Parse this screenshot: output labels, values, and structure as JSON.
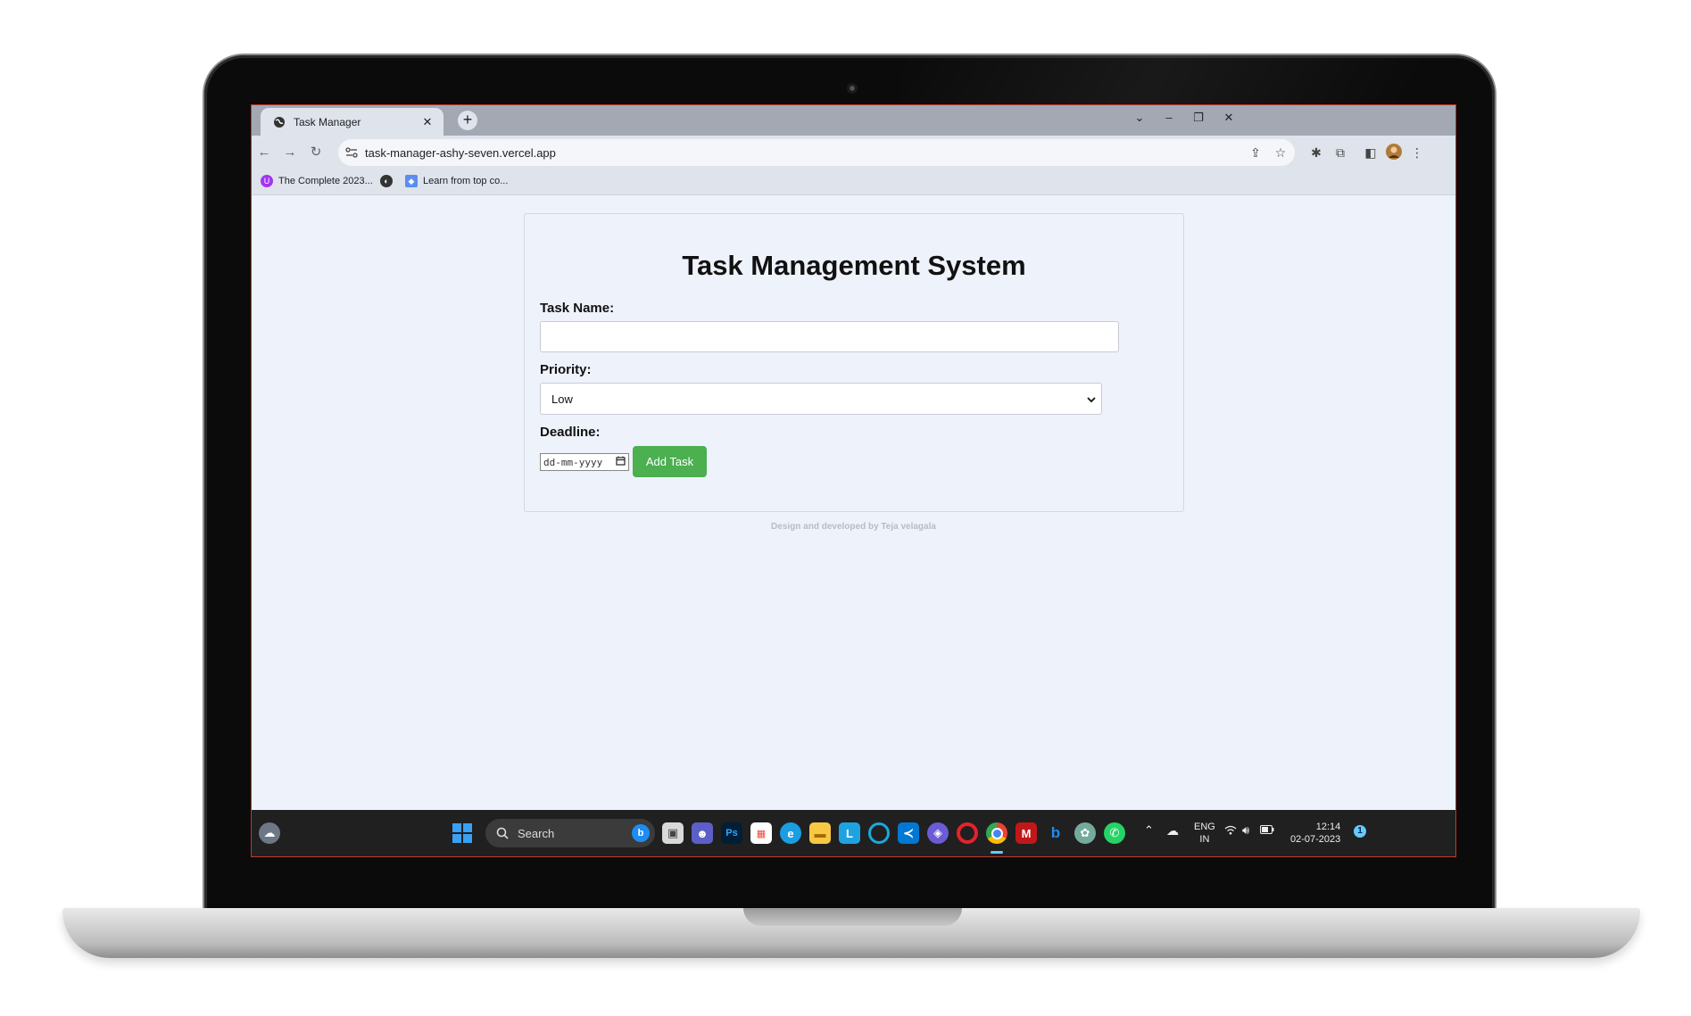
{
  "browser": {
    "tab_title": "Task Manager",
    "tab_close": "✕",
    "new_tab": "+",
    "url": "task-manager-ashy-seven.vercel.app",
    "window_controls": {
      "dropdown": "⌄",
      "minimize": "–",
      "restore": "❐",
      "close": "✕"
    },
    "bookmarks": [
      {
        "label": "The Complete 2023...",
        "icon": "udemy-icon"
      },
      {
        "label": "",
        "icon": "globe-icon"
      },
      {
        "label": "Learn from top co...",
        "icon": "gem-icon"
      }
    ]
  },
  "page": {
    "title": "Task Management System",
    "task_name_label": "Task Name:",
    "task_name_value": "",
    "priority_label": "Priority:",
    "priority_value": "Low",
    "deadline_label": "Deadline:",
    "deadline_placeholder": "dd-mm-yyyy",
    "add_button": "Add Task",
    "footer": "Design and developed by Teja velagala"
  },
  "taskbar": {
    "search_label": "Search",
    "language": "ENG",
    "region": "IN",
    "time": "12:14",
    "date": "02-07-2023",
    "notification_count": "1"
  },
  "colors": {
    "add_button": "#4caf50",
    "page_background": "#eef2fb",
    "taskbar": "#202020"
  }
}
